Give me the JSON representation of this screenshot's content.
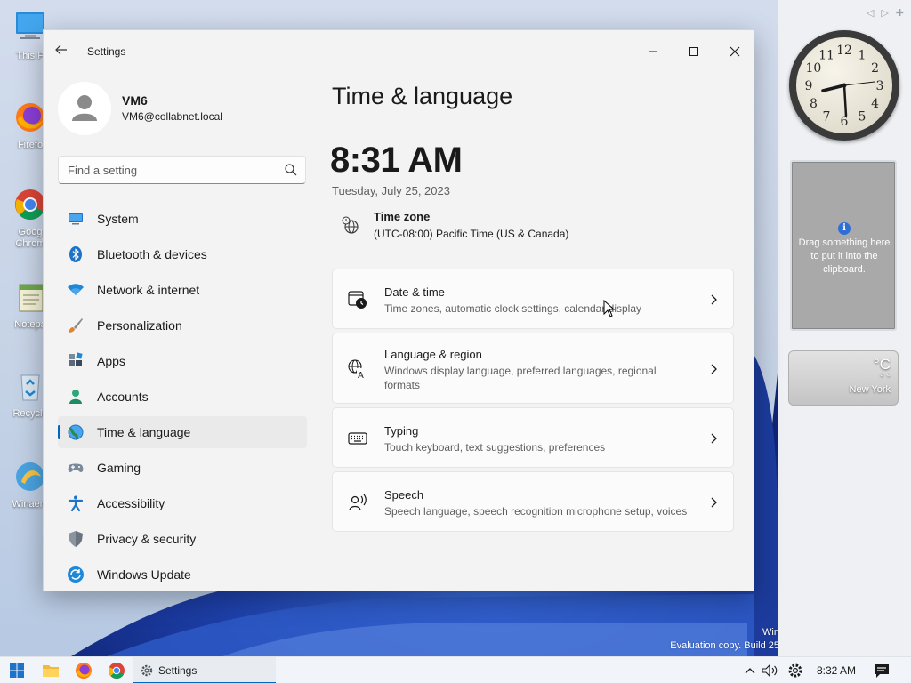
{
  "desktop": {
    "icons": [
      {
        "label": "This P",
        "icon": "computer-icon"
      },
      {
        "label": "Firefo",
        "icon": "firefox-icon"
      },
      {
        "label": "Goog",
        "label2": "Chrom",
        "icon": "chrome-icon"
      },
      {
        "label": "Notepa",
        "icon": "notepad-icon"
      },
      {
        "label": "Recycle",
        "icon": "recycle-bin-icon"
      },
      {
        "label": "Winaero",
        "icon": "winaero-icon"
      }
    ],
    "watermark_line1": "Win",
    "watermark_line2": "Evaluation copy. Build 25"
  },
  "gadgets": {
    "clock_numbers": [
      "12",
      "1",
      "2",
      "3",
      "4",
      "5",
      "6",
      "7",
      "8",
      "9",
      "10",
      "11"
    ],
    "clip_text": "Drag something here to put it into the clipboard.",
    "weather_unit": "°C",
    "weather_dots": "° °",
    "weather_city": "New York"
  },
  "window": {
    "title": "Settings",
    "minimize_icon": "minimize-icon",
    "maximize_icon": "maximize-icon",
    "close_icon": "close-icon"
  },
  "profile": {
    "name": "VM6",
    "email": "VM6@collabnet.local"
  },
  "search": {
    "placeholder": "Find a setting"
  },
  "nav": {
    "items": [
      {
        "label": "System",
        "icon": "system-icon"
      },
      {
        "label": "Bluetooth & devices",
        "icon": "bluetooth-icon"
      },
      {
        "label": "Network & internet",
        "icon": "wifi-icon"
      },
      {
        "label": "Personalization",
        "icon": "brush-icon"
      },
      {
        "label": "Apps",
        "icon": "apps-icon"
      },
      {
        "label": "Accounts",
        "icon": "accounts-icon"
      },
      {
        "label": "Time & language",
        "icon": "time-language-icon",
        "active": true
      },
      {
        "label": "Gaming",
        "icon": "gamepad-icon"
      },
      {
        "label": "Accessibility",
        "icon": "accessibility-icon"
      },
      {
        "label": "Privacy & security",
        "icon": "shield-icon"
      },
      {
        "label": "Windows Update",
        "icon": "update-icon"
      }
    ]
  },
  "main": {
    "title": "Time & language",
    "time": "8:31 AM",
    "date": "Tuesday, July 25, 2023",
    "timezone_label": "Time zone",
    "timezone_value": "(UTC-08:00) Pacific Time (US & Canada)",
    "cards": [
      {
        "title": "Date & time",
        "desc": "Time zones, automatic clock settings, calendar display",
        "icon": "calendar-clock-icon"
      },
      {
        "title": "Language & region",
        "desc": "Windows display language, preferred languages, regional formats",
        "icon": "language-icon"
      },
      {
        "title": "Typing",
        "desc": "Touch keyboard, text suggestions, preferences",
        "icon": "keyboard-icon"
      },
      {
        "title": "Speech",
        "desc": "Speech language, speech recognition microphone setup, voices",
        "icon": "speech-icon"
      }
    ]
  },
  "taskbar": {
    "settings_label": "Settings",
    "time": "8:32 AM"
  }
}
